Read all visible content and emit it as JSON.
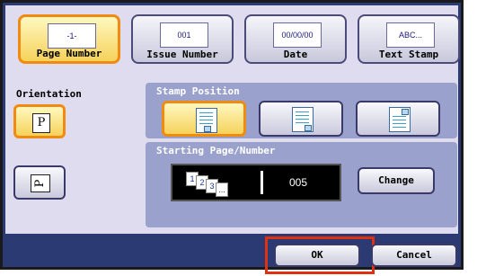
{
  "tabs": [
    {
      "thumb": "-1-",
      "label": "Page Number",
      "active": true
    },
    {
      "thumb": "001",
      "label": "Issue Number",
      "active": false
    },
    {
      "thumb": "00/00/00",
      "label": "Date",
      "active": false
    },
    {
      "thumb": "ABC...",
      "label": "Text Stamp",
      "active": false
    }
  ],
  "orientation": {
    "label": "Orientation",
    "portrait_glyph": "P",
    "landscape_glyph": "P"
  },
  "stamp_position": {
    "title": "Stamp Position",
    "selected": "left"
  },
  "starting": {
    "title": "Starting Page/Number",
    "pages": [
      "1",
      "2",
      "3",
      "..."
    ],
    "value": "005",
    "change_label": "Change"
  },
  "footer": {
    "ok_label": "OK",
    "cancel_label": "Cancel"
  },
  "colors": {
    "accent": "#f08a10",
    "highlight": "#e03010",
    "panel": "#dedcee",
    "section": "#9aa1cc",
    "frame": "#2b3a72"
  }
}
